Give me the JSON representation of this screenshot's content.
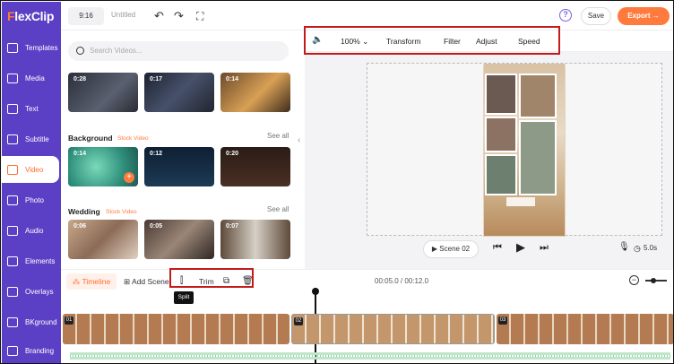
{
  "brand": {
    "name_first": "F",
    "name_rest": "lexClip",
    "accent": "#ff7a3d",
    "sidebar_color": "#5b3fc4"
  },
  "sidebar": {
    "items": [
      {
        "label": "Templates",
        "icon": "templates-icon"
      },
      {
        "label": "Media",
        "icon": "media-icon"
      },
      {
        "label": "Text",
        "icon": "text-icon"
      },
      {
        "label": "Subtitle",
        "icon": "subtitle-icon"
      },
      {
        "label": "Video",
        "icon": "video-icon",
        "active": true
      },
      {
        "label": "Photo",
        "icon": "photo-icon"
      },
      {
        "label": "Audio",
        "icon": "audio-icon"
      },
      {
        "label": "Elements",
        "icon": "elements-icon"
      },
      {
        "label": "Overlays",
        "icon": "overlays-icon"
      },
      {
        "label": "BKground",
        "icon": "background-icon"
      },
      {
        "label": "Branding",
        "icon": "branding-icon"
      }
    ]
  },
  "topbar": {
    "ratio": "9:16",
    "title": "Untitled",
    "undo": "↶",
    "redo": "↷",
    "fullscreen": "⛶",
    "help": "?",
    "save": "Save",
    "export": "Export →"
  },
  "media_panel": {
    "search_placeholder": "Search Videos...",
    "top_row": [
      {
        "duration": "0:28"
      },
      {
        "duration": "0:17"
      },
      {
        "duration": "0:14"
      }
    ],
    "sections": [
      {
        "title": "Background",
        "tag": "Stock Video",
        "see_all": "See all",
        "items": [
          {
            "duration": "0:14"
          },
          {
            "duration": "0:12"
          },
          {
            "duration": "0:20"
          }
        ]
      },
      {
        "title": "Wedding",
        "tag": "Stock Video",
        "see_all": "See all",
        "items": [
          {
            "duration": "0:06"
          },
          {
            "duration": "0:05"
          },
          {
            "duration": "0:07"
          }
        ]
      }
    ]
  },
  "edit_toolbar": {
    "volume_icon": "volume-icon",
    "zoom": "100%",
    "transform": "Transform",
    "filter": "Filter",
    "adjust": "Adjust",
    "speed": "Speed"
  },
  "player": {
    "scene": "Scene 02",
    "duration": "5.0s"
  },
  "timeline": {
    "tab": "Timeline",
    "add_scene": "Add Scene",
    "trim": "Trim",
    "split_tooltip": "Split",
    "time": "00:05.0 / 00:12.0",
    "clips": [
      {
        "no": "01"
      },
      {
        "no": "02"
      },
      {
        "no": "03"
      }
    ]
  }
}
